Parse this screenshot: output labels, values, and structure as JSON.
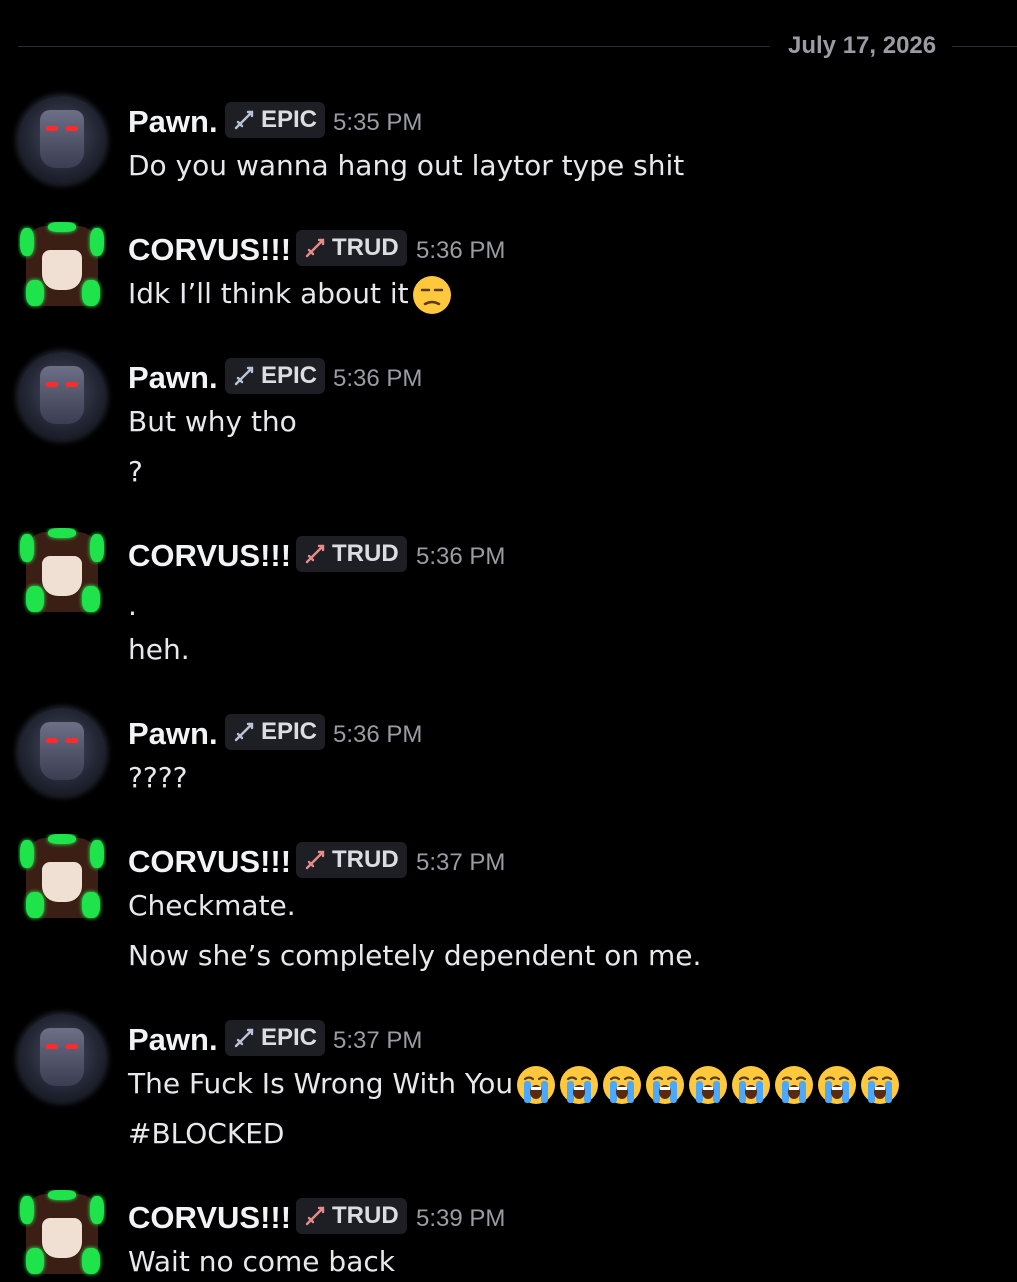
{
  "date_divider": "July 17, 2026",
  "colors": {
    "background": "#000000",
    "name": "#f2f3f5",
    "muted": "#9a9ba3",
    "tag_bg": "#1e1f24",
    "emoji_yellow": "#ffc83d",
    "emoji_tear": "#4aa8ff",
    "avatar_green": "#1ee34a"
  },
  "messages": [
    {
      "author": "Pawn.",
      "avatar": "pawn-avatar",
      "tag": "EPIC",
      "tag_icon": "sword-icon",
      "time": "5:35 PM",
      "lines": [
        "Do you wanna hang out laytor type shit"
      ]
    },
    {
      "author": "CORVUS!!!",
      "avatar": "corvus-avatar",
      "tag": "TRUD",
      "tag_icon": "sword-icon",
      "time": "5:36 PM",
      "lines": [
        "Idk I’ll think about it"
      ],
      "emoji": "unamused-face-emoji"
    },
    {
      "author": "Pawn.",
      "avatar": "pawn-avatar",
      "tag": "EPIC",
      "tag_icon": "sword-icon",
      "time": "5:36 PM",
      "lines": [
        "But why tho",
        "?"
      ]
    },
    {
      "author": "CORVUS!!!",
      "avatar": "corvus-avatar",
      "tag": "TRUD",
      "tag_icon": "sword-icon",
      "time": "5:36 PM",
      "lines": [
        ".",
        "heh."
      ]
    },
    {
      "author": "Pawn.",
      "avatar": "pawn-avatar",
      "tag": "EPIC",
      "tag_icon": "sword-icon",
      "time": "5:36 PM",
      "lines": [
        "????"
      ]
    },
    {
      "author": "CORVUS!!!",
      "avatar": "corvus-avatar",
      "tag": "TRUD",
      "tag_icon": "sword-icon",
      "time": "5:37 PM",
      "lines": [
        "Checkmate.",
        "Now she’s completely dependent on me."
      ]
    },
    {
      "author": "Pawn.",
      "avatar": "pawn-avatar",
      "tag": "EPIC",
      "tag_icon": "sword-icon",
      "time": "5:37 PM",
      "lines": [
        "The Fuck Is Wrong With You",
        "#BLOCKED"
      ],
      "emoji": "loudly-crying-face-emoji",
      "emoji_count": 9
    },
    {
      "author": "CORVUS!!!",
      "avatar": "corvus-avatar",
      "tag": "TRUD",
      "tag_icon": "sword-icon",
      "time": "5:39 PM",
      "lines": [
        "Wait no come back"
      ]
    }
  ]
}
